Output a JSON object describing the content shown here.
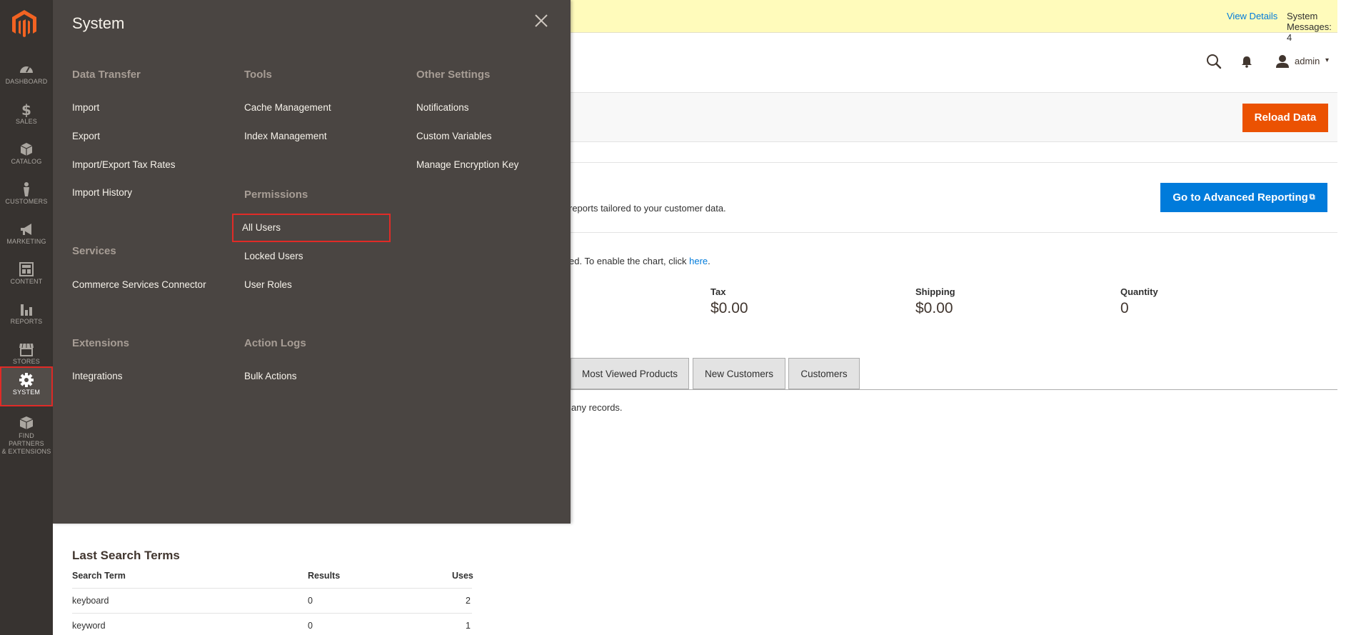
{
  "sidebar": {
    "items": [
      {
        "label": "DASHBOARD",
        "icon": "dashboard-icon"
      },
      {
        "label": "SALES",
        "icon": "dollar-icon"
      },
      {
        "label": "CATALOG",
        "icon": "cube-icon"
      },
      {
        "label": "CUSTOMERS",
        "icon": "person-icon"
      },
      {
        "label": "MARKETING",
        "icon": "megaphone-icon"
      },
      {
        "label": "CONTENT",
        "icon": "layout-icon"
      },
      {
        "label": "REPORTS",
        "icon": "bar-chart-icon"
      },
      {
        "label": "STORES",
        "icon": "storefront-icon"
      },
      {
        "label": "SYSTEM",
        "icon": "gear-icon"
      },
      {
        "label": "FIND PARTNERS",
        "label2": "& EXTENSIONS",
        "icon": "boxes-icon"
      }
    ]
  },
  "flyout": {
    "title": "System",
    "groups": {
      "data_transfer": {
        "title": "Data Transfer",
        "links": [
          "Import",
          "Export",
          "Import/Export Tax Rates",
          "Import History"
        ]
      },
      "services": {
        "title": "Services",
        "links": [
          "Commerce Services Connector"
        ]
      },
      "extensions": {
        "title": "Extensions",
        "links": [
          "Integrations"
        ]
      },
      "tools": {
        "title": "Tools",
        "links": [
          "Cache Management",
          "Index Management"
        ]
      },
      "permissions": {
        "title": "Permissions",
        "links": [
          "All Users",
          "Locked Users",
          "User Roles"
        ]
      },
      "action_logs": {
        "title": "Action Logs",
        "links": [
          "Bulk Actions"
        ]
      },
      "other_settings": {
        "title": "Other Settings",
        "links": [
          "Notifications",
          "Custom Variables",
          "Manage Encryption Key"
        ]
      }
    }
  },
  "notice": {
    "view_details": "View Details",
    "messages": "System Messages: 4"
  },
  "header": {
    "user": "admin"
  },
  "actions": {
    "reload": "Reload Data"
  },
  "advanced": {
    "text": "reports tailored to your customer data.",
    "button": "Go to Advanced Reporting"
  },
  "chart_note": {
    "text": "ed. To enable the chart, click ",
    "link": "here",
    "tail": "."
  },
  "metrics": [
    {
      "label": "Tax",
      "value": "$0.00"
    },
    {
      "label": "Shipping",
      "value": "$0.00"
    },
    {
      "label": "Quantity",
      "value": "0"
    }
  ],
  "tabs": [
    "Most Viewed Products",
    "New Customers",
    "Customers"
  ],
  "no_records": "any records.",
  "last_search": {
    "title": "Last Search Terms",
    "headers": [
      "Search Term",
      "Results",
      "Uses"
    ],
    "rows": [
      [
        "keyboard",
        "0",
        "2"
      ],
      [
        "keyword",
        "0",
        "1"
      ]
    ]
  },
  "colors": {
    "sidebar": "#373330",
    "flyout": "#4a4542",
    "accent_orange": "#eb5202",
    "accent_blue": "#007bdb",
    "highlight_red": "#e02b27"
  }
}
